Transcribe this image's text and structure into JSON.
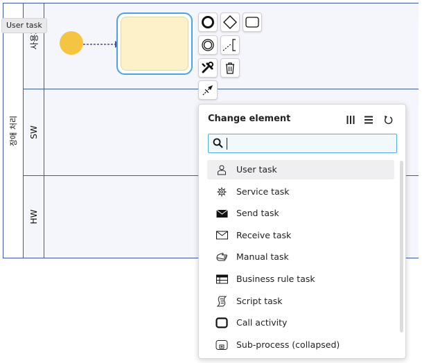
{
  "tooltip": "User task",
  "pool": {
    "label": "장애 처리"
  },
  "lanes": [
    {
      "label": "사용자"
    },
    {
      "label": "SW"
    },
    {
      "label": "HW"
    }
  ],
  "context_pad": {
    "icons": [
      "end-event-icon",
      "gateway-icon",
      "task-icon",
      "intermediate-event-icon",
      "text-annotation-icon",
      "wrench-icon",
      "delete-icon",
      "connect-icon"
    ]
  },
  "popup": {
    "title": "Change element",
    "search_placeholder": "",
    "items": [
      {
        "label": "User task",
        "icon": "user-task-icon",
        "active": true
      },
      {
        "label": "Service task",
        "icon": "service-task-icon"
      },
      {
        "label": "Send task",
        "icon": "send-task-icon"
      },
      {
        "label": "Receive task",
        "icon": "receive-task-icon"
      },
      {
        "label": "Manual task",
        "icon": "manual-task-icon"
      },
      {
        "label": "Business rule task",
        "icon": "business-rule-task-icon"
      },
      {
        "label": "Script task",
        "icon": "script-task-icon"
      },
      {
        "label": "Call activity",
        "icon": "call-activity-icon"
      },
      {
        "label": "Sub-process (collapsed)",
        "icon": "sub-process-collapsed-icon"
      }
    ]
  },
  "colors": {
    "lane_border": "#3b5ba5",
    "task_fill": "#fdf1c9",
    "selection": "#4aa3e8",
    "start_event": "#f5c542",
    "flow": "#4a4f8a"
  }
}
